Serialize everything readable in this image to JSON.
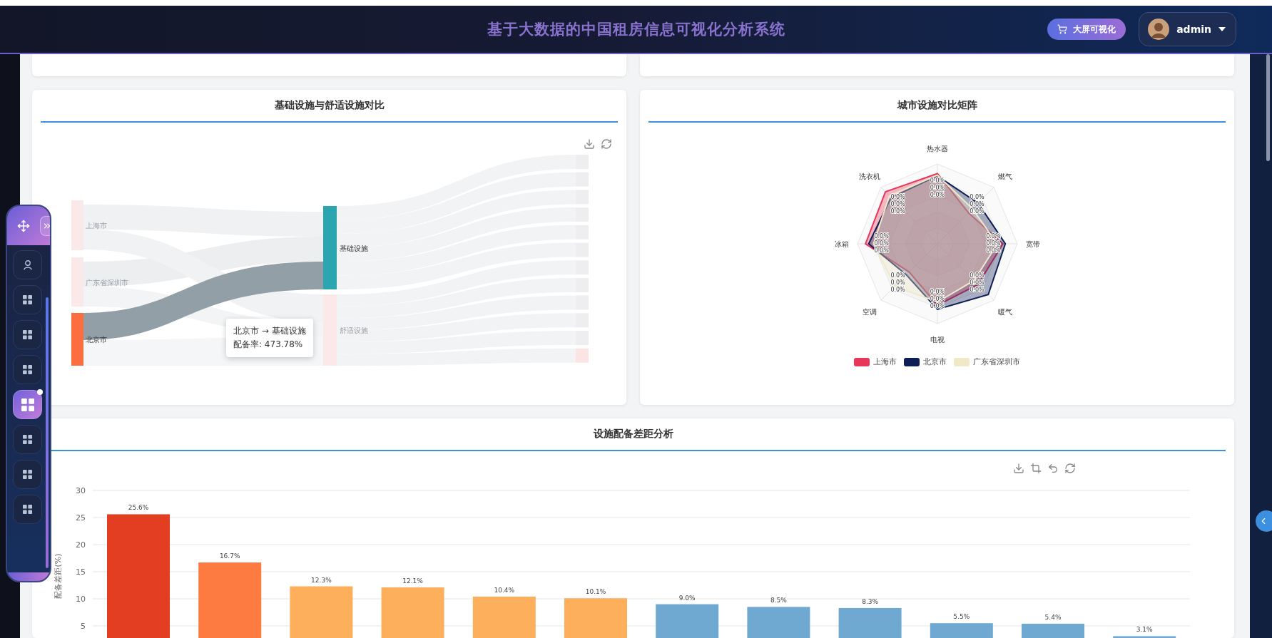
{
  "header": {
    "title": "基于大数据的中国租房信息可视化分析系统",
    "screen_button": "大屏可视化",
    "user": "admin"
  },
  "sidebar": {
    "items": [
      {
        "kind": "user",
        "selected": false
      },
      {
        "kind": "grid",
        "selected": false
      },
      {
        "kind": "grid",
        "selected": false
      },
      {
        "kind": "grid",
        "selected": false
      },
      {
        "kind": "grid",
        "selected": true
      },
      {
        "kind": "grid",
        "selected": false
      },
      {
        "kind": "grid",
        "selected": false
      },
      {
        "kind": "grid",
        "selected": false
      }
    ]
  },
  "sankey_card": {
    "title": "基础设施与舒适设施对比",
    "nodes": [
      {
        "label": "上海市",
        "highlighted": false
      },
      {
        "label": "广东省深圳市",
        "highlighted": false
      },
      {
        "label": "北京市",
        "highlighted": true
      },
      {
        "label": "基础设施",
        "highlighted": true
      },
      {
        "label": "舒适设施",
        "highlighted": false
      }
    ],
    "tooltip": {
      "title": "北京市 → 基础设施",
      "value": "配备率: 473.78%"
    }
  },
  "radar_card": {
    "title": "城市设施对比矩阵",
    "indicators": [
      "热水器",
      "燃气",
      "宽带",
      "暖气",
      "电视",
      "空调",
      "冰箱",
      "洗衣机"
    ],
    "series": [
      {
        "name": "上海市",
        "color": "#e8365a",
        "labels": [
          "0.0%",
          "0.0%",
          "0.0%",
          "0.0%",
          "0.0%",
          "0.0%",
          "0.0%",
          "0.0%"
        ]
      },
      {
        "name": "北京市",
        "color": "#0d1d55",
        "labels": [
          "0.0%",
          "0.0%",
          "0.0%",
          "0.0%",
          "0.0%",
          "0.0%",
          "0.0%",
          "0.0%"
        ]
      },
      {
        "name": "广东省深圳市",
        "color": "#f1e8c8",
        "labels": [
          "0.0%",
          "0.0%",
          "0.0%",
          "0.0%",
          "0.0%",
          "0.0%",
          "0.0%",
          "0.0%"
        ]
      }
    ]
  },
  "gap_card": {
    "title": "设施配备差距分析",
    "chart_data": {
      "type": "bar",
      "ylabel": "配备差距(%)",
      "ylim": [
        0,
        30
      ],
      "yticks": [
        5,
        10,
        15,
        20,
        25,
        30
      ],
      "grid": true,
      "stacked": true,
      "series": [
        {
          "color": "#e33e22",
          "values": [
            25.6,
            null,
            null,
            null,
            null,
            null,
            null,
            null,
            null,
            null,
            null,
            null
          ]
        },
        {
          "color": "#fd7a41",
          "values": [
            null,
            16.7,
            null,
            null,
            null,
            null,
            null,
            null,
            null,
            null,
            null,
            null
          ]
        },
        {
          "color": "#fdaf5b",
          "values": [
            null,
            null,
            12.3,
            12.1,
            10.4,
            10.1,
            null,
            null,
            null,
            null,
            null,
            null
          ]
        },
        {
          "color": "#6fa8d0",
          "values": [
            null,
            null,
            null,
            null,
            null,
            null,
            9.0,
            8.5,
            8.3,
            5.5,
            5.4,
            3.1
          ]
        }
      ],
      "value_labels": [
        "25.6%",
        "16.7%",
        "12.3%",
        "12.1%",
        "10.4%",
        "10.1%",
        "9.0%",
        "8.5%",
        "8.3%",
        "5.5%",
        "5.4%",
        "3.1%"
      ]
    }
  }
}
